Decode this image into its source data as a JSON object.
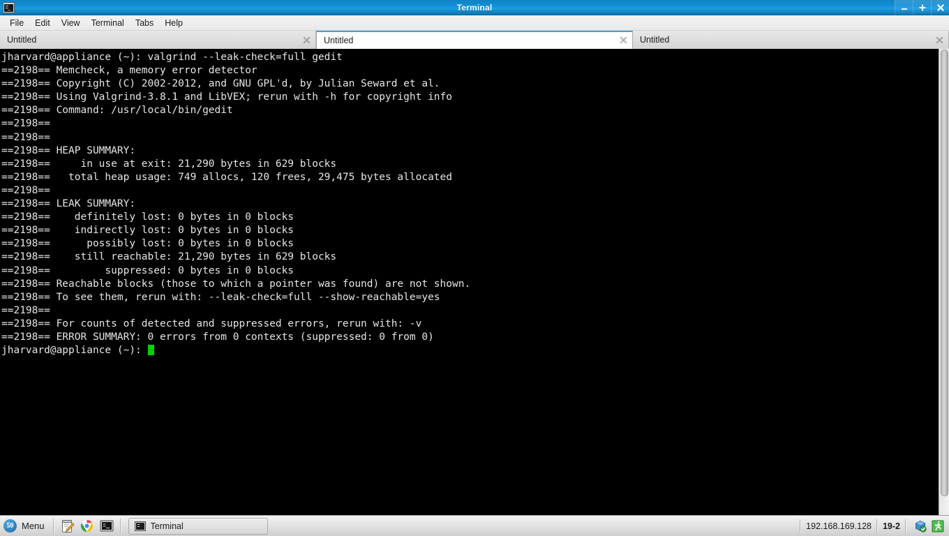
{
  "window": {
    "title": "Terminal",
    "app_icon": "terminal-icon",
    "controls": [
      {
        "name": "minimize-button",
        "glyph": "minimize-icon"
      },
      {
        "name": "maximize-button",
        "glyph": "maximize-icon"
      },
      {
        "name": "close-button",
        "glyph": "close-icon"
      }
    ]
  },
  "menubar": {
    "items": [
      {
        "label": "File"
      },
      {
        "label": "Edit"
      },
      {
        "label": "View"
      },
      {
        "label": "Terminal"
      },
      {
        "label": "Tabs"
      },
      {
        "label": "Help"
      }
    ]
  },
  "tabs": [
    {
      "label": "Untitled",
      "active": false,
      "close_icon": "close-icon"
    },
    {
      "label": "Untitled",
      "active": true,
      "close_icon": "close-icon"
    },
    {
      "label": "Untitled",
      "active": false,
      "close_icon": "close-icon"
    }
  ],
  "terminal": {
    "background": "#000000",
    "foreground": "#e6e6e6",
    "cursor_color": "#00d200",
    "lines": [
      "jharvard@appliance (~): valgrind --leak-check=full gedit",
      "==2198== Memcheck, a memory error detector",
      "==2198== Copyright (C) 2002-2012, and GNU GPL'd, by Julian Seward et al.",
      "==2198== Using Valgrind-3.8.1 and LibVEX; rerun with -h for copyright info",
      "==2198== Command: /usr/local/bin/gedit",
      "==2198== ",
      "==2198== ",
      "==2198== HEAP SUMMARY:",
      "==2198==     in use at exit: 21,290 bytes in 629 blocks",
      "==2198==   total heap usage: 749 allocs, 120 frees, 29,475 bytes allocated",
      "==2198== ",
      "==2198== LEAK SUMMARY:",
      "==2198==    definitely lost: 0 bytes in 0 blocks",
      "==2198==    indirectly lost: 0 bytes in 0 blocks",
      "==2198==      possibly lost: 0 bytes in 0 blocks",
      "==2198==    still reachable: 21,290 bytes in 629 blocks",
      "==2198==         suppressed: 0 bytes in 0 blocks",
      "==2198== Reachable blocks (those to which a pointer was found) are not shown.",
      "==2198== To see them, rerun with: --leak-check=full --show-reachable=yes",
      "==2198== ",
      "==2198== For counts of detected and suppressed errors, rerun with: -v",
      "==2198== ERROR SUMMARY: 0 errors from 0 contexts (suppressed: 0 from 0)"
    ],
    "prompt": "jharvard@appliance (~): ",
    "scrollbar": "vertical-scrollbar"
  },
  "taskbar": {
    "menu_button": {
      "label": "Menu",
      "logo_text": "50"
    },
    "launchers": [
      {
        "name": "gedit-icon",
        "title": "gedit"
      },
      {
        "name": "chrome-icon",
        "title": "Chrome"
      },
      {
        "name": "terminal-icon",
        "title": "Terminal"
      }
    ],
    "windows": [
      {
        "label": "Terminal",
        "icon": "terminal-icon",
        "active": true
      }
    ],
    "tray": {
      "ip_address": "192.168.169.128",
      "workspace": "19-2",
      "icons": [
        {
          "name": "update-manager-icon"
        },
        {
          "name": "logout-icon"
        }
      ]
    }
  }
}
